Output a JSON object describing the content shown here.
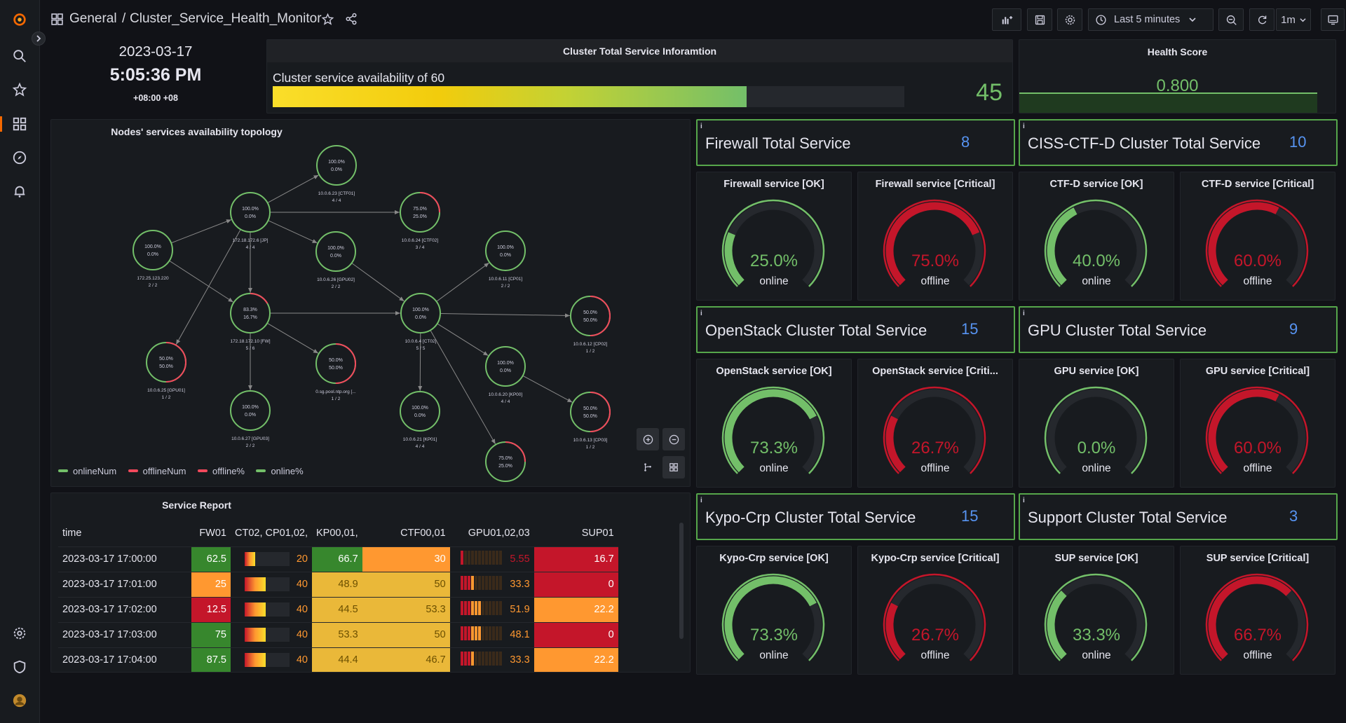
{
  "breadcrumb": {
    "root": "General",
    "separator": "/",
    "dashboard": "Cluster_Service_Health_Monitor"
  },
  "toolbar": {
    "time_range": "Last 5 minutes",
    "refresh": "1m"
  },
  "clock": {
    "date": "2023-03-17",
    "time": "5:05:36 PM",
    "tz": "+08:00 +08"
  },
  "cluster_info": {
    "title": "Cluster Total Service Inforamtion",
    "bar_label": "Cluster service availability of 60",
    "value": "45",
    "fill_fraction": 0.75
  },
  "health": {
    "title": "Health Score",
    "value": "0.800"
  },
  "topology": {
    "title": "Nodes' services availability topology",
    "legend": [
      "onlineNum",
      "offlineNum",
      "offline%",
      "online%"
    ],
    "nodes": [
      {
        "id": "n1",
        "p1": "100.0%",
        "p2": "0.0%",
        "name": "172.25.123.220",
        "count": "2 / 2",
        "state": "ok"
      },
      {
        "id": "n2",
        "p1": "100.0%",
        "p2": "0.0%",
        "name": "172.18.172.6 [JP]",
        "count": "4 / 4",
        "state": "ok"
      },
      {
        "id": "n3",
        "p1": "100.0%",
        "p2": "0.0%",
        "name": "10.0.6.23 [CTF01]",
        "count": "4 / 4",
        "state": "ok"
      },
      {
        "id": "n4",
        "p1": "75.0%",
        "p2": "25.0%",
        "name": "10.0.6.24 [CTF02]",
        "count": "3 / 4",
        "state": "warn"
      },
      {
        "id": "n5",
        "p1": "100.0%",
        "p2": "0.0%",
        "name": "10.0.6.26 [GPU02]",
        "count": "2 / 2",
        "state": "ok"
      },
      {
        "id": "n6",
        "p1": "83.3%",
        "p2": "16.7%",
        "name": "172.18.172.10 [FW]",
        "count": "5 / 6",
        "state": "warn"
      },
      {
        "id": "n7",
        "p1": "50.0%",
        "p2": "50.0%",
        "name": "10.0.6.25 [GPU01]",
        "count": "1 / 2",
        "state": "half"
      },
      {
        "id": "n8",
        "p1": "50.0%",
        "p2": "50.0%",
        "name": "0.sg.pool.ntp.org [...",
        "count": "1 / 2",
        "state": "half"
      },
      {
        "id": "n9",
        "p1": "100.0%",
        "p2": "0.0%",
        "name": "10.0.6.27 [GPU03]",
        "count": "2 / 2",
        "state": "ok"
      },
      {
        "id": "n10",
        "p1": "100.0%",
        "p2": "0.0%",
        "name": "10.0.6.4 [CT02]",
        "count": "5 / 5",
        "state": "ok"
      },
      {
        "id": "n11",
        "p1": "100.0%",
        "p2": "0.0%",
        "name": "10.0.6.11 [CP01]",
        "count": "2 / 2",
        "state": "ok"
      },
      {
        "id": "n12",
        "p1": "50.0%",
        "p2": "50.0%",
        "name": "10.0.6.12 [CP02]",
        "count": "1 / 2",
        "state": "half"
      },
      {
        "id": "n13",
        "p1": "100.0%",
        "p2": "0.0%",
        "name": "10.0.6.20 [KP00]",
        "count": "4 / 4",
        "state": "ok"
      },
      {
        "id": "n14",
        "p1": "100.0%",
        "p2": "0.0%",
        "name": "10.0.6.21 [KP01]",
        "count": "4 / 4",
        "state": "ok"
      },
      {
        "id": "n15",
        "p1": "50.0%",
        "p2": "50.0%",
        "name": "10.0.6.13 [CP03]",
        "count": "1 / 2",
        "state": "half"
      },
      {
        "id": "n16",
        "p1": "75.0%",
        "p2": "25.0%",
        "name": "",
        "count": "",
        "state": "warn"
      }
    ]
  },
  "report": {
    "title": "Service Report",
    "columns": [
      "time",
      "FW01",
      "CT02, CP01,02,",
      "KP00,01,",
      "CTF00,01",
      "GPU01,02,03",
      "SUP01"
    ],
    "rows": [
      {
        "time": "2023-03-17 17:00:00",
        "fw": "62.5",
        "ct": "20",
        "kp": "66.7",
        "ctf": "30",
        "gpu": "5.55",
        "sup": "16.7"
      },
      {
        "time": "2023-03-17 17:01:00",
        "fw": "25",
        "ct": "40",
        "kp": "48.9",
        "ctf": "50",
        "gpu": "33.3",
        "sup": "0"
      },
      {
        "time": "2023-03-17 17:02:00",
        "fw": "12.5",
        "ct": "40",
        "kp": "44.5",
        "ctf": "53.3",
        "gpu": "51.9",
        "sup": "22.2"
      },
      {
        "time": "2023-03-17 17:03:00",
        "fw": "75",
        "ct": "40",
        "kp": "53.3",
        "ctf": "50",
        "gpu": "48.1",
        "sup": "0"
      },
      {
        "time": "2023-03-17 17:04:00",
        "fw": "87.5",
        "ct": "40",
        "kp": "44.4",
        "ctf": "46.7",
        "gpu": "33.3",
        "sup": "22.2"
      }
    ]
  },
  "groups": [
    {
      "title": "Firewall Total Service",
      "value": "8",
      "ok": {
        "title": "Firewall service [OK]",
        "value": "25.0%",
        "label": "online",
        "fraction": 0.25
      },
      "crit": {
        "title": "Firewall service [Critical]",
        "value": "75.0%",
        "label": "offline",
        "fraction": 0.75
      }
    },
    {
      "title": "CISS-CTF-D Cluster Total Service",
      "value": "10",
      "ok": {
        "title": "CTF-D service [OK]",
        "value": "40.0%",
        "label": "online",
        "fraction": 0.4
      },
      "crit": {
        "title": "CTF-D service [Critical]",
        "value": "60.0%",
        "label": "offline",
        "fraction": 0.6
      }
    },
    {
      "title": "OpenStack Cluster Total Service",
      "value": "15",
      "ok": {
        "title": "OpenStack service [OK]",
        "value": "73.3%",
        "label": "online",
        "fraction": 0.733
      },
      "crit": {
        "title": "OpenStack service [Criti...",
        "value": "26.7%",
        "label": "offline",
        "fraction": 0.267
      }
    },
    {
      "title": "GPU Cluster Total Service",
      "value": "9",
      "ok": {
        "title": "GPU service [OK]",
        "value": "0.0%",
        "label": "online",
        "fraction": 0.0
      },
      "crit": {
        "title": "GPU service [Critical]",
        "value": "60.0%",
        "label": "offline",
        "fraction": 0.6
      }
    },
    {
      "title": "Kypo-Crp Cluster Total Service",
      "value": "15",
      "ok": {
        "title": "Kypo-Crp service [OK]",
        "value": "73.3%",
        "label": "online",
        "fraction": 0.733
      },
      "crit": {
        "title": "Kypo-Crp service [Critical]",
        "value": "26.7%",
        "label": "offline",
        "fraction": 0.267
      }
    },
    {
      "title": "Support Cluster Total Service",
      "value": "3",
      "ok": {
        "title": "SUP service [OK]",
        "value": "33.3%",
        "label": "online",
        "fraction": 0.333
      },
      "crit": {
        "title": "SUP service [Critical]",
        "value": "66.7%",
        "label": "offline",
        "fraction": 0.667
      }
    }
  ],
  "colors": {
    "ok": "#73bf69",
    "crit": "#c4162a",
    "accent": "#5794f2",
    "orange": "#ff9830",
    "yellow": "#eab839",
    "red": "#d44a3a",
    "dark_red": "#c4162a",
    "green": "#37872d"
  }
}
